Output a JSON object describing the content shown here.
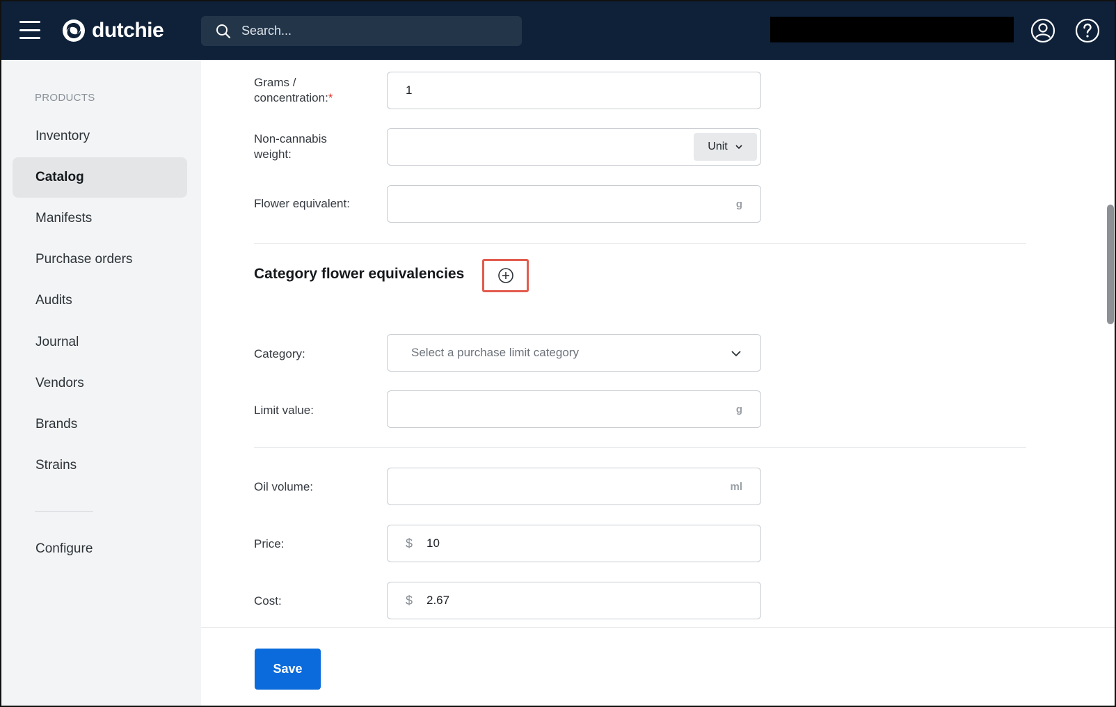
{
  "header": {
    "brand": "dutchie",
    "search_placeholder": "Search..."
  },
  "sidebar": {
    "section": "PRODUCTS",
    "items": [
      {
        "label": "Inventory",
        "active": false
      },
      {
        "label": "Catalog",
        "active": true
      },
      {
        "label": "Manifests",
        "active": false
      },
      {
        "label": "Purchase orders",
        "active": false
      },
      {
        "label": "Audits",
        "active": false
      },
      {
        "label": "Journal",
        "active": false
      },
      {
        "label": "Vendors",
        "active": false
      },
      {
        "label": "Brands",
        "active": false
      },
      {
        "label": "Strains",
        "active": false
      }
    ],
    "configure": "Configure"
  },
  "form": {
    "grams": {
      "label_line1": "Grams /",
      "label_line2": "concentration:",
      "required_mark": "*",
      "value": "1"
    },
    "non_cannabis": {
      "label_line1": "Non-cannabis",
      "label_line2": "weight:",
      "value": "",
      "unit": "Unit"
    },
    "flower_equivalent": {
      "label": "Flower equivalent:",
      "value": "",
      "suffix": "g"
    },
    "category_section": {
      "title": "Category flower equivalencies"
    },
    "category": {
      "label": "Category:",
      "placeholder": "Select a purchase limit category"
    },
    "limit_value": {
      "label": "Limit value:",
      "value": "",
      "suffix": "g"
    },
    "oil_volume": {
      "label": "Oil volume:",
      "value": "",
      "suffix": "ml"
    },
    "price": {
      "label": "Price:",
      "currency": "$",
      "value": "10"
    },
    "cost": {
      "label": "Cost:",
      "currency": "$",
      "value": "2.67"
    }
  },
  "footer": {
    "save_label": "Save"
  },
  "colors": {
    "topbar": "#0e2139",
    "primary": "#0b6bdc",
    "highlight": "#e25b4d",
    "required": "#e0332b"
  }
}
